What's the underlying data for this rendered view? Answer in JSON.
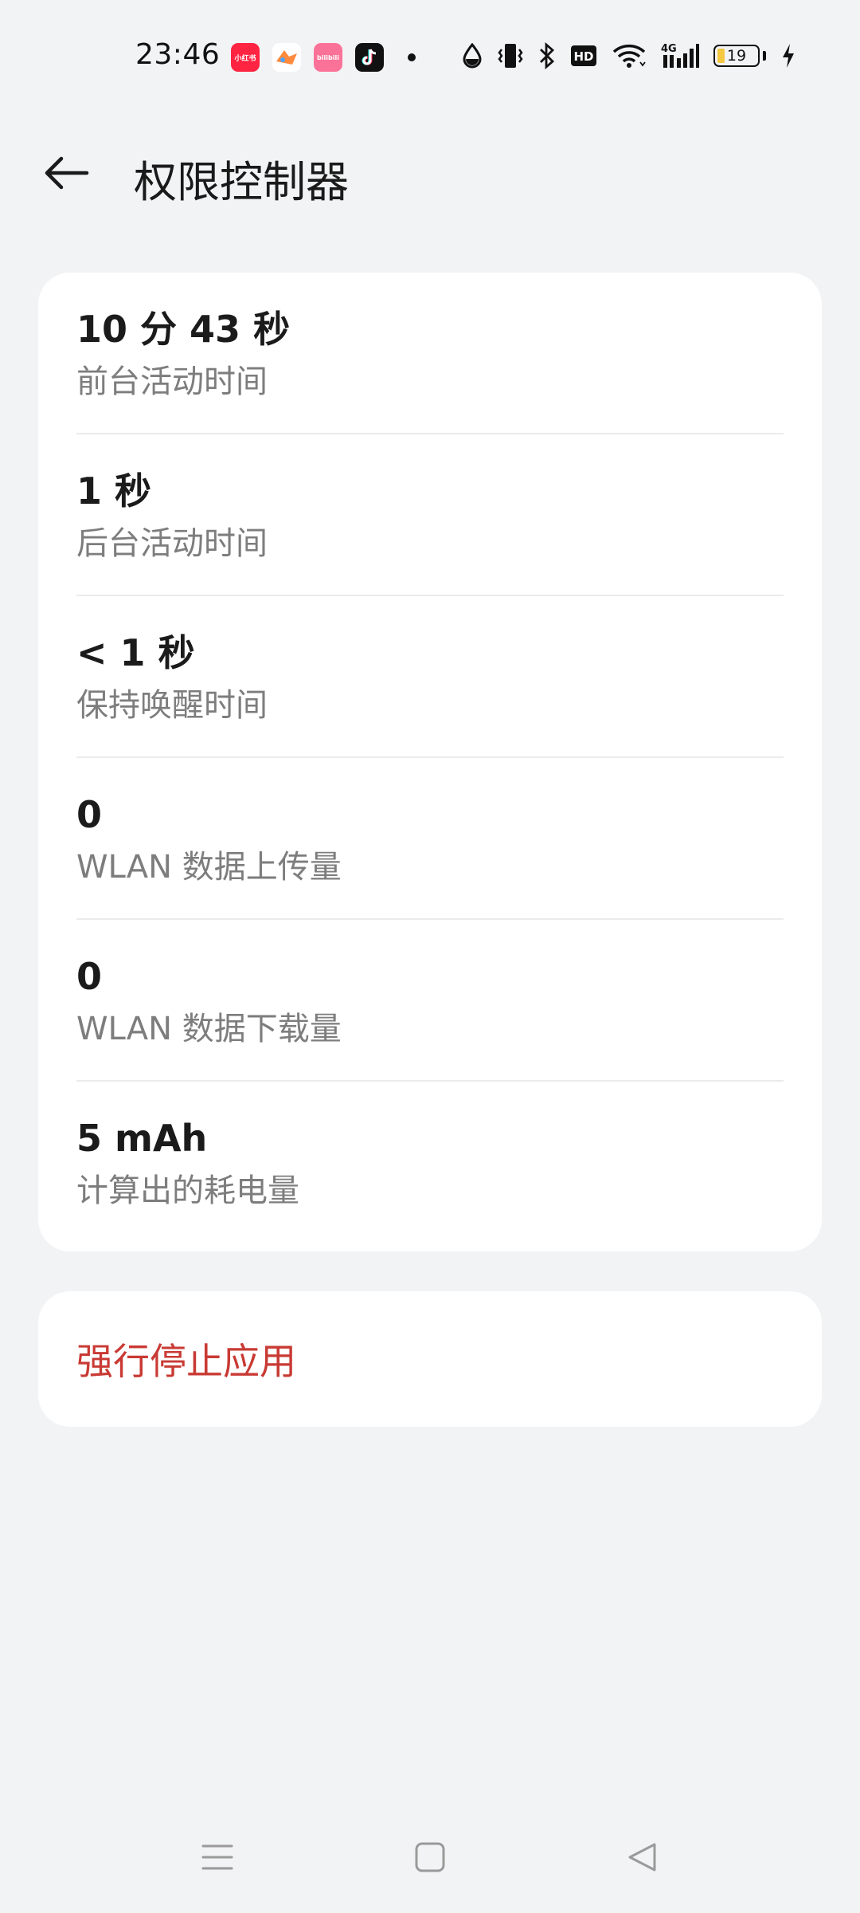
{
  "status_bar": {
    "time": "23:46",
    "battery_level": "19",
    "battery_fraction": 0.19,
    "app_icons": [
      {
        "name": "xiaohongshu-icon",
        "color": "#ff2442",
        "label": "小红书"
      },
      {
        "name": "game-icon",
        "color": "#ff8a3d",
        "label": ""
      },
      {
        "name": "bilibili-icon",
        "color": "#fb7299",
        "label": "bilibili"
      },
      {
        "name": "tiktok-icon",
        "color": "#111111",
        "label": ""
      }
    ],
    "network": "4G"
  },
  "header": {
    "title": "权限控制器"
  },
  "stats": [
    {
      "value": "10 分 43 秒",
      "label": "前台活动时间"
    },
    {
      "value": "1 秒",
      "label": "后台活动时间"
    },
    {
      "value": "< 1 秒",
      "label": "保持唤醒时间"
    },
    {
      "value": "0",
      "label": "WLAN 数据上传量"
    },
    {
      "value": "0",
      "label": "WLAN 数据下载量"
    },
    {
      "value": "5 mAh",
      "label": "计算出的耗电量"
    }
  ],
  "actions": {
    "force_stop_label": "强行停止应用"
  },
  "colors": {
    "background": "#f2f3f5",
    "card": "#ffffff",
    "danger": "#c93a34",
    "secondary_text": "#7d7d7d"
  }
}
